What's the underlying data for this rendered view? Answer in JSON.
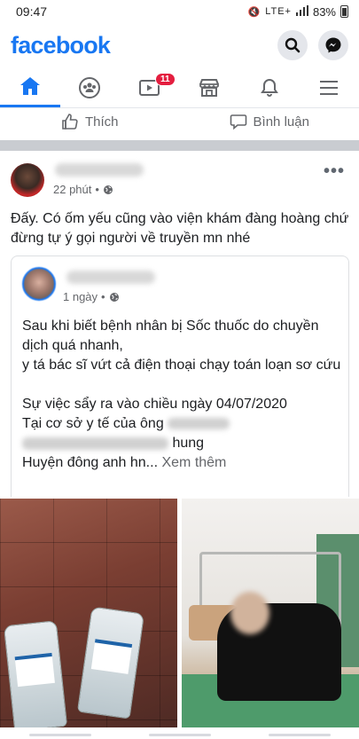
{
  "status_bar": {
    "time": "09:47",
    "network": "LTE+",
    "battery": "83%"
  },
  "header": {
    "logo": "facebook",
    "search_icon": "search-icon",
    "messenger_icon": "messenger-icon"
  },
  "nav": {
    "tabs": [
      {
        "name": "home",
        "icon": "home-icon",
        "active": true
      },
      {
        "name": "groups",
        "icon": "groups-icon",
        "active": false
      },
      {
        "name": "watch",
        "icon": "video-icon",
        "active": false,
        "badge": "11"
      },
      {
        "name": "marketplace",
        "icon": "marketplace-icon",
        "active": false
      },
      {
        "name": "notifications",
        "icon": "bell-icon",
        "active": false
      },
      {
        "name": "menu",
        "icon": "menu-icon",
        "active": false
      }
    ],
    "accent_color": "#1877f2"
  },
  "previous_post_actions": {
    "like_label": "Thích",
    "comment_label": "Bình luận"
  },
  "post": {
    "time": "22 phút",
    "text": "Đấy. Có ốm yếu cũng vào viện khám đàng hoàng chứ đừng tự ý gọi người về truyền mn nhé",
    "shared": {
      "time": "1 ngày",
      "body_p1": "Sau khi biết bệnh nhân bị Sốc thuốc do chuyền dịch  quá nhanh,\n y tá bác sĩ vứt cả điện thoại chạy toán loạn sơ cứu",
      "body_p2_line1": "Sự việc sẩy ra vào chiều ngày 04/07/2020",
      "body_p2_line2": "Tại cơ sở y tế của ông",
      "body_p2_line3_end": "hung",
      "body_p2_line4": "Huyện  đông anh hn...",
      "see_more": "Xem thêm"
    }
  }
}
